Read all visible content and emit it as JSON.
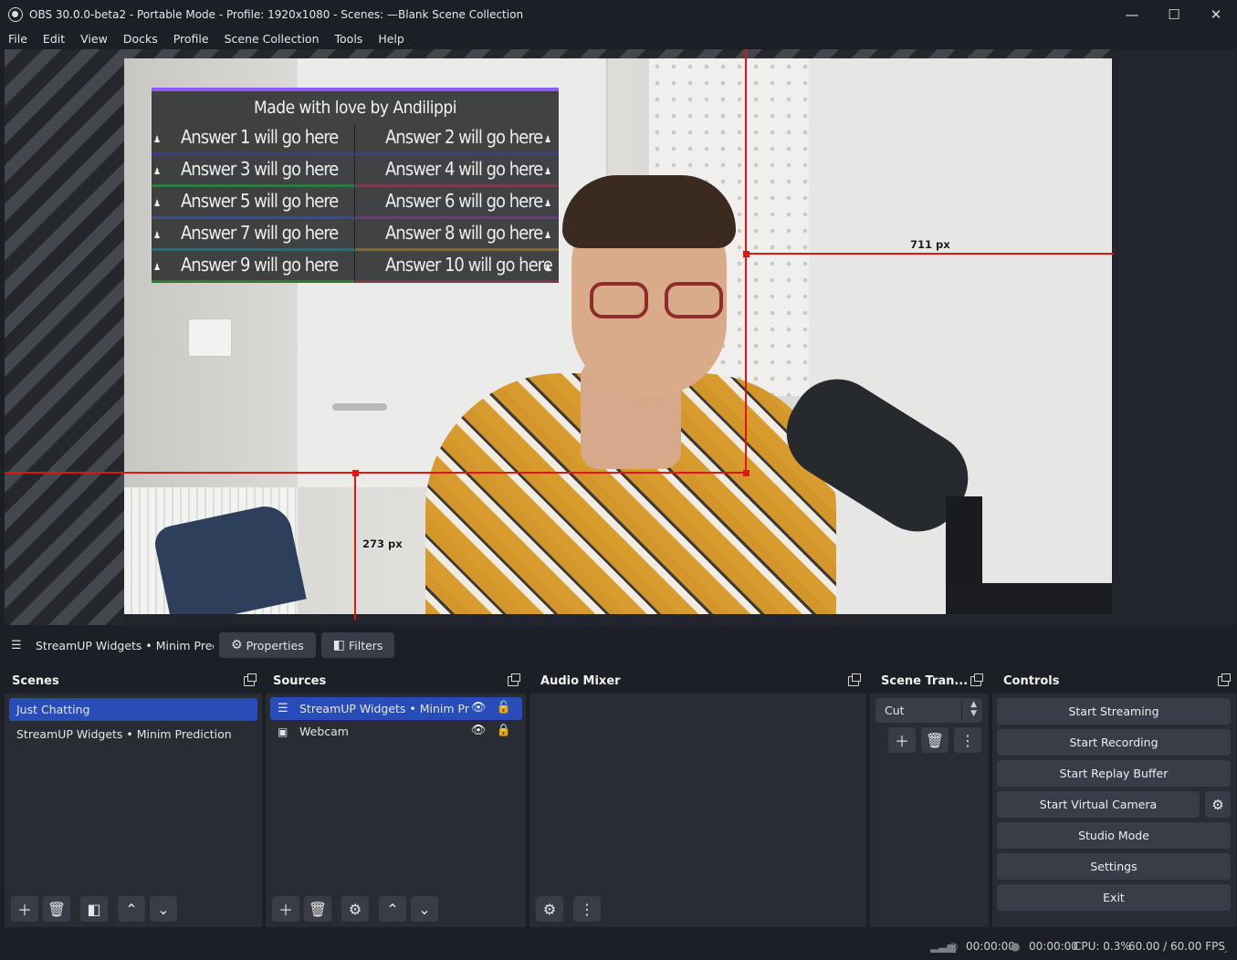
{
  "window": {
    "title": "OBS 30.0.0-beta2 - Portable Mode - Profile: 1920x1080 - Scenes: —Blank Scene Collection",
    "minimize": "—",
    "maximize": "☐",
    "close": "✕"
  },
  "menu": [
    "File",
    "Edit",
    "View",
    "Docks",
    "Profile",
    "Scene Collection",
    "Tools",
    "Help"
  ],
  "preview": {
    "widget_title": "Made with love by Andilippi",
    "answers": [
      [
        "Answer 1 will go here",
        "Answer 2 will go here"
      ],
      [
        "Answer 3 will go here",
        "Answer 4 will go here"
      ],
      [
        "Answer 5 will go here",
        "Answer 6 will go here"
      ],
      [
        "Answer 7 will go here",
        "Answer 8 will go here"
      ],
      [
        "Answer 9 will go here",
        "Answer 10 will go here"
      ]
    ],
    "guide_right_label": "711 px",
    "guide_bottom_label": "273 px",
    "guide_color": "#e01515"
  },
  "source_toolbar": {
    "source_name": "StreamUP Widgets • Minim Predic",
    "properties_label": "Properties",
    "filters_label": "Filters"
  },
  "scenes": {
    "title": "Scenes",
    "items": [
      "Just Chatting",
      "StreamUP Widgets • Minim Prediction"
    ],
    "selected": "Just Chatting"
  },
  "sources": {
    "title": "Sources",
    "items": [
      {
        "name": "StreamUP Widgets • Minim Predi",
        "icon": "list-icon"
      },
      {
        "name": "Webcam",
        "icon": "image-icon"
      }
    ]
  },
  "audio_mixer": {
    "title": "Audio Mixer"
  },
  "scene_transitions": {
    "title": "Scene Tran...",
    "selected": "Cut"
  },
  "controls": {
    "title": "Controls",
    "buttons": [
      "Start Streaming",
      "Start Recording",
      "Start Replay Buffer",
      "Start Virtual Camera",
      "Studio Mode",
      "Settings",
      "Exit"
    ]
  },
  "status": {
    "stream_time": "00:00:00",
    "rec_time": "00:00:00",
    "cpu": "CPU: 0.3%",
    "fps": "60.00 / 60.00 FPS"
  },
  "colors": {
    "accent": "#284cb8",
    "background": "#1d1f26",
    "panel": "#2a2c34",
    "button": "#3a3d47",
    "widget_border": "#8b5cf6"
  }
}
